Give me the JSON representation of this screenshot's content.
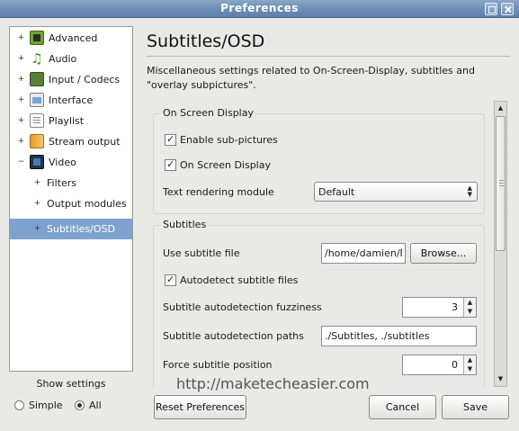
{
  "window": {
    "title": "Preferences"
  },
  "sidebar": {
    "items": [
      {
        "label": "Advanced",
        "expander": "+"
      },
      {
        "label": "Audio",
        "expander": "+"
      },
      {
        "label": "Input / Codecs",
        "expander": "+"
      },
      {
        "label": "Interface",
        "expander": "+"
      },
      {
        "label": "Playlist",
        "expander": "+"
      },
      {
        "label": "Stream output",
        "expander": "+"
      },
      {
        "label": "Video",
        "expander": "−"
      },
      {
        "label": "Filters",
        "expander": "+"
      },
      {
        "label": "Output modules",
        "expander": "+"
      },
      {
        "label": "Subtitles/OSD",
        "expander": "+"
      }
    ],
    "selected": "Subtitles/OSD"
  },
  "show_settings": {
    "header": "Show settings",
    "simple_label": "Simple",
    "all_label": "All",
    "selected": "All"
  },
  "panel": {
    "title": "Subtitles/OSD",
    "description": "Miscellaneous settings related to On-Screen-Display, subtitles and \"overlay subpictures\".",
    "osd_group": {
      "title": "On Screen Display",
      "enable_subpictures": {
        "label": "Enable sub-pictures",
        "checked": true
      },
      "on_screen_display": {
        "label": "On Screen Display",
        "checked": true
      },
      "text_rendering_label": "Text rendering module",
      "text_rendering_value": "Default"
    },
    "subtitles_group": {
      "title": "Subtitles",
      "use_subtitle_file_label": "Use subtitle file",
      "use_subtitle_file_value": "/home/damien/My",
      "browse_label": "Browse...",
      "autodetect": {
        "label": "Autodetect subtitle files",
        "checked": true
      },
      "fuzziness_label": "Subtitle autodetection fuzziness",
      "fuzziness_value": "3",
      "paths_label": "Subtitle autodetection paths",
      "paths_value": "./Subtitles, ./subtitles",
      "force_position_label": "Force subtitle position",
      "force_position_value": "0"
    }
  },
  "footer": {
    "reset_label": "Reset Preferences",
    "cancel_label": "Cancel",
    "save_label": "Save"
  },
  "watermark": "http://maketecheasier.com",
  "icons": [
    "advanced-icon",
    "audio-icon",
    "codecs-icon",
    "interface-icon",
    "playlist-icon",
    "stream-output-icon",
    "video-icon"
  ],
  "colors": {
    "titlebar": "#6c8cb4",
    "selection": "#7ea2cd"
  }
}
